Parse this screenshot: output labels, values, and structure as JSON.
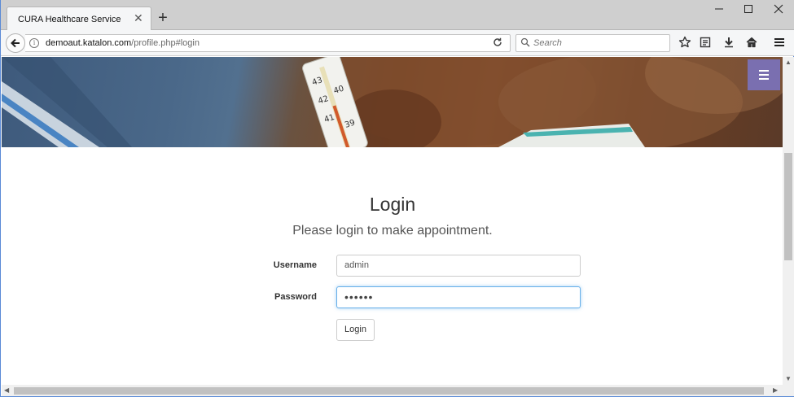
{
  "browser": {
    "tab_title": "CURA Healthcare Service",
    "url_host": "demoaut.katalon.com",
    "url_path": "/profile.php#login",
    "url_prefix": "",
    "search_placeholder": "Search"
  },
  "page": {
    "title": "Login",
    "subtitle": "Please login to make appointment.",
    "username_label": "Username",
    "username_value": "admin",
    "password_label": "Password",
    "password_value": "••••••",
    "login_button": "Login"
  },
  "colors": {
    "menu_toggle": "#7a6fb0",
    "focus_border": "#66afe9"
  }
}
